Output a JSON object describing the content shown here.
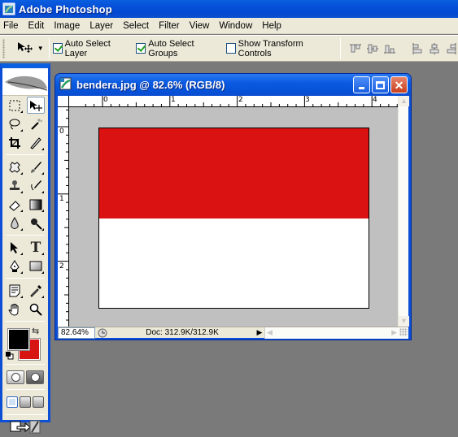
{
  "app": {
    "title": "Adobe Photoshop",
    "icon": "photoshop-icon"
  },
  "menubar": {
    "items": [
      "File",
      "Edit",
      "Image",
      "Layer",
      "Select",
      "Filter",
      "View",
      "Window",
      "Help"
    ]
  },
  "options_bar": {
    "tool_preset_icon": "move-tool-icon",
    "checkboxes": [
      {
        "label": "Auto Select Layer",
        "checked": true
      },
      {
        "label": "Auto Select Groups",
        "checked": true
      },
      {
        "label": "Show Transform Controls",
        "checked": false
      }
    ],
    "align_icons": [
      "align-top-edges-icon",
      "align-vertical-centers-icon",
      "align-bottom-edges-icon",
      "align-left-edges-icon",
      "align-horizontal-centers-icon",
      "align-right-edges-icon"
    ]
  },
  "toolbox": {
    "tools": [
      [
        "rectangular-marquee-tool",
        "move-tool"
      ],
      [
        "lasso-tool",
        "magic-wand-tool"
      ],
      [
        "crop-tool",
        "slice-tool"
      ],
      [
        "healing-brush-tool",
        "brush-tool"
      ],
      [
        "clone-stamp-tool",
        "history-brush-tool"
      ],
      [
        "eraser-tool",
        "gradient-tool"
      ],
      [
        "blur-tool",
        "dodge-tool"
      ],
      [
        "path-selection-tool",
        "type-tool"
      ],
      [
        "pen-tool",
        "rectangle-tool"
      ],
      [
        "notes-tool",
        "eyedropper-tool"
      ],
      [
        "hand-tool",
        "zoom-tool"
      ]
    ],
    "active_tool": "move-tool",
    "foreground_color": "#000000",
    "background_color": "#d71313"
  },
  "document": {
    "title": "bendera.jpg @ 82.6% (RGB/8)",
    "ruler_top_labels": [
      "0",
      "1",
      "2",
      "3",
      "4"
    ],
    "ruler_left_labels": [
      "0",
      "1",
      "2"
    ],
    "image": {
      "top_color": "#da1212",
      "bottom_color": "#ffffff"
    },
    "status": {
      "zoom": "82.64%",
      "doc_info": "Doc: 312.9K/312.9K"
    }
  }
}
